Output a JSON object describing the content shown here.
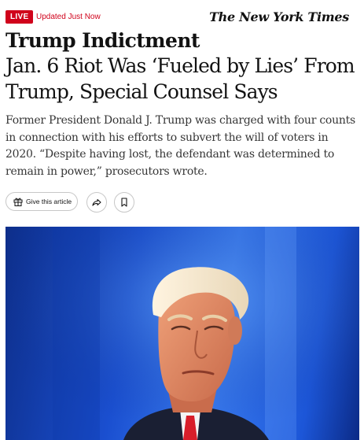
{
  "status": {
    "live_label": "LIVE",
    "updated_text": "Updated Just Now"
  },
  "publication": {
    "logo_text": "The New York Times"
  },
  "article": {
    "kicker": "Trump Indictment",
    "headline": "Jan. 6 Riot Was ‘Fueled by Lies’ From Trump, Special Counsel Says",
    "summary": "Former President Donald J. Trump was charged with four counts in connection with his efforts to subvert the will of voters in 2020. “Despite having lost, the defendant was determined to remain in power,” prosecutors wrote."
  },
  "actions": {
    "gift_label": "Give this article",
    "gift_icon": "gift-icon",
    "share_icon": "share-icon",
    "save_icon": "bookmark-icon"
  },
  "colors": {
    "live_red": "#d0021b",
    "text": "#121212",
    "summary_text": "#363636",
    "photo_background": "#1a4fd0"
  }
}
